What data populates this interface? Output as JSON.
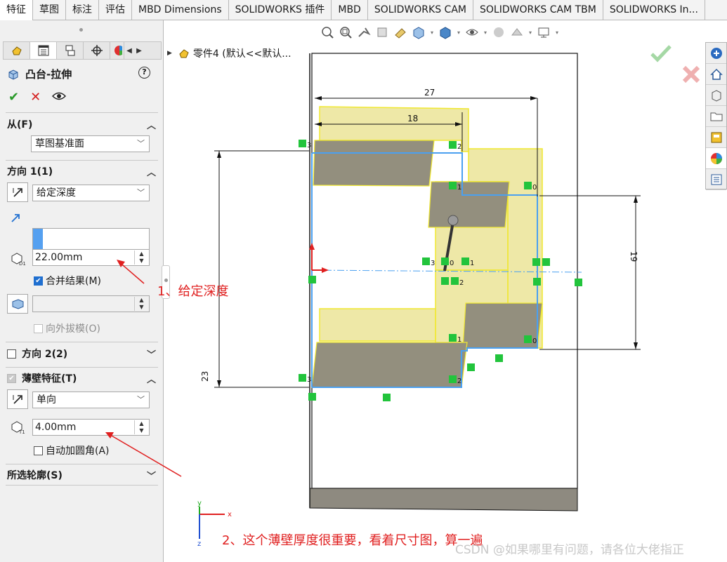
{
  "tabs": [
    "特征",
    "草图",
    "标注",
    "评估",
    "MBD Dimensions",
    "SOLIDWORKS 插件",
    "MBD",
    "SOLIDWORKS CAM",
    "SOLIDWORKS CAM TBM",
    "SOLIDWORKS In..."
  ],
  "active_tab_index": 0,
  "property_manager": {
    "title": "凸台-拉伸",
    "help": "?",
    "from": {
      "label": "从(F)",
      "value": "草图基准面"
    },
    "direction1": {
      "label": "方向 1(1)",
      "end_condition": "给定深度",
      "depth": "22.00mm",
      "merge_result": "合并结果(M)",
      "merge_checked": true,
      "draft_outward": "向外拔模(O)",
      "draft_checked": false
    },
    "direction2": {
      "label": "方向 2(2)",
      "checked": false
    },
    "thin_feature": {
      "label": "薄壁特征(T)",
      "checked": true,
      "type": "单向",
      "thickness": "4.00mm",
      "auto_fillet": "自动加圆角(A)",
      "auto_fillet_checked": false
    },
    "selected_contours": {
      "label": "所选轮廓(S)"
    }
  },
  "tree": {
    "item": "零件4 (默认<<默认..."
  },
  "dimensions": {
    "d27": "27",
    "d18": "18",
    "d19": "19",
    "d23": "23"
  },
  "constraint_labels": [
    "3",
    "2",
    "1",
    "0",
    "3",
    "0",
    "1",
    "2",
    "1",
    "0",
    "3",
    "2"
  ],
  "triad": {
    "x": "x",
    "y": "y",
    "z": "z"
  },
  "annotations": {
    "a1": "1、给定深度",
    "a2": "2、这个薄壁厚度很重要，看着尺寸图，算一遍"
  },
  "watermark": "CSDN @如果哪里有问题，请各位大佬指正",
  "colors": {
    "accent_blue": "#1f6fd0",
    "sketch_blue": "#4aa0f0",
    "preview_yellow": "#e8e08a",
    "annotation_red": "#e02020",
    "relation_green": "#22c43c"
  }
}
